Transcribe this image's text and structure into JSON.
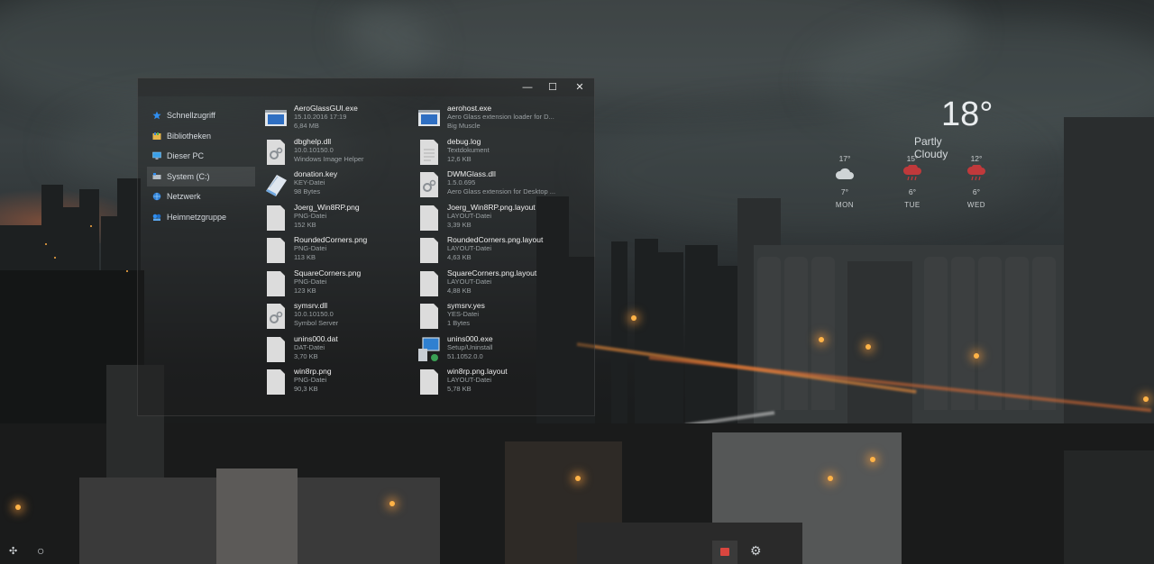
{
  "window": {
    "caption_minimize": "—",
    "caption_maximize": "☐",
    "caption_close": "✕",
    "nav": [
      {
        "label": "Schnellzugriff",
        "icon": "star-icon"
      },
      {
        "label": "Bibliotheken",
        "icon": "library-icon"
      },
      {
        "label": "Dieser PC",
        "icon": "computer-icon"
      },
      {
        "label": "System (C:)",
        "icon": "drive-icon",
        "selected": true
      },
      {
        "label": "Netzwerk",
        "icon": "network-icon"
      },
      {
        "label": "Heimnetzgruppe",
        "icon": "homegroup-icon"
      }
    ],
    "files": [
      {
        "name": "AeroGlassGUI.exe",
        "line1": "15.10.2016 17:19",
        "line2": "6,84 MB",
        "icon": "exe-window-icon"
      },
      {
        "name": "aerohost.exe",
        "line1": "Aero Glass extension loader for D...",
        "line2": "Big Muscle",
        "icon": "exe-window-icon"
      },
      {
        "name": "dbghelp.dll",
        "line1": "10.0.10150.0",
        "line2": "Windows Image Helper",
        "icon": "dll-gear-icon"
      },
      {
        "name": "debug.log",
        "line1": "Textdokument",
        "line2": "12,6 KB",
        "icon": "text-document-icon"
      },
      {
        "name": "donation.key",
        "line1": "KEY-Datei",
        "line2": "98 Bytes",
        "icon": "key-file-icon"
      },
      {
        "name": "DWMGlass.dll",
        "line1": "1.5.0.695",
        "line2": "Aero Glass extension for Desktop ...",
        "icon": "dll-gear-icon"
      },
      {
        "name": "Joerg_Win8RP.png",
        "line1": "PNG-Datei",
        "line2": "152 KB",
        "icon": "png-document-icon"
      },
      {
        "name": "Joerg_Win8RP.png.layout",
        "line1": "LAYOUT-Datei",
        "line2": "3,39 KB",
        "icon": "layout-document-icon"
      },
      {
        "name": "RoundedCorners.png",
        "line1": "PNG-Datei",
        "line2": "113 KB",
        "icon": "png-document-icon"
      },
      {
        "name": "RoundedCorners.png.layout",
        "line1": "LAYOUT-Datei",
        "line2": "4,63 KB",
        "icon": "layout-document-icon"
      },
      {
        "name": "SquareCorners.png",
        "line1": "PNG-Datei",
        "line2": "123 KB",
        "icon": "png-document-icon"
      },
      {
        "name": "SquareCorners.png.layout",
        "line1": "LAYOUT-Datei",
        "line2": "4,88 KB",
        "icon": "layout-document-icon"
      },
      {
        "name": "symsrv.dll",
        "line1": "10.0.10150.0",
        "line2": "Symbol Server",
        "icon": "dll-gear-icon"
      },
      {
        "name": "symsrv.yes",
        "line1": "YES-Datei",
        "line2": "1 Bytes",
        "icon": "yes-document-icon"
      },
      {
        "name": "unins000.dat",
        "line1": "DAT-Datei",
        "line2": "3,70 KB",
        "icon": "dat-document-icon"
      },
      {
        "name": "unins000.exe",
        "line1": "Setup/Uninstall",
        "line2": "51.1052.0.0",
        "icon": "setup-computer-icon"
      },
      {
        "name": "win8rp.png",
        "line1": "PNG-Datei",
        "line2": "90,3 KB",
        "icon": "png-document-icon"
      },
      {
        "name": "win8rp.png.layout",
        "line1": "LAYOUT-Datei",
        "line2": "5,78 KB",
        "icon": "layout-document-icon"
      }
    ]
  },
  "weather": {
    "temperature": "18°",
    "condition": "Partly Cloudy",
    "forecast": [
      {
        "day": "MON",
        "high": "17°",
        "low": "7°",
        "icon": "cloud-icon"
      },
      {
        "day": "TUE",
        "high": "15°",
        "low": "6°",
        "icon": "rain-cloud-icon"
      },
      {
        "day": "WED",
        "high": "12°",
        "low": "6°",
        "icon": "rain-cloud-icon"
      }
    ],
    "colors": {
      "rain_icon": "#c0393b",
      "cloud_icon": "#cfd4d6"
    }
  },
  "taskbar": {
    "start_glyph": "✣",
    "search_glyph": "○",
    "settings_glyph": "⚙",
    "accent": "#d9463f"
  }
}
